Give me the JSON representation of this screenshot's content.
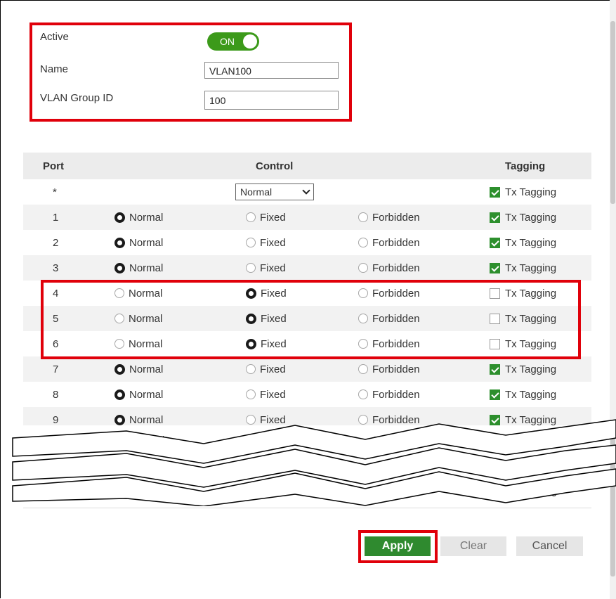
{
  "form": {
    "active_label": "Active",
    "active_toggle": "ON",
    "name_label": "Name",
    "name_value": "VLAN100",
    "group_label": "VLAN Group ID",
    "group_value": "100"
  },
  "table": {
    "headers": {
      "port": "Port",
      "control": "Control",
      "tagging": "Tagging"
    },
    "all_row": {
      "port": "*",
      "control_select": "Normal",
      "tagging": "Tx Tagging"
    },
    "options": {
      "normal": "Normal",
      "fixed": "Fixed",
      "forbidden": "Forbidden",
      "tx": "Tx Tagging"
    },
    "rows": [
      {
        "port": "1",
        "control": "normal",
        "tx": true
      },
      {
        "port": "2",
        "control": "normal",
        "tx": true
      },
      {
        "port": "3",
        "control": "normal",
        "tx": true
      },
      {
        "port": "4",
        "control": "fixed",
        "tx": false
      },
      {
        "port": "5",
        "control": "fixed",
        "tx": false
      },
      {
        "port": "6",
        "control": "fixed",
        "tx": false
      },
      {
        "port": "7",
        "control": "normal",
        "tx": true
      },
      {
        "port": "8",
        "control": "normal",
        "tx": true
      },
      {
        "port": "9",
        "control": "normal",
        "tx": true
      }
    ],
    "truncated_rows": [
      {
        "control": "normal",
        "tx": true
      },
      {
        "control": "normal",
        "tx": true
      },
      {
        "control": "normal",
        "tx": true
      }
    ]
  },
  "buttons": {
    "apply": "Apply",
    "clear": "Clear",
    "cancel": "Cancel"
  },
  "colors": {
    "accent_green": "#2f8a2f",
    "highlight_red": "#e0000a",
    "toggle_green": "#3c9a1a"
  }
}
